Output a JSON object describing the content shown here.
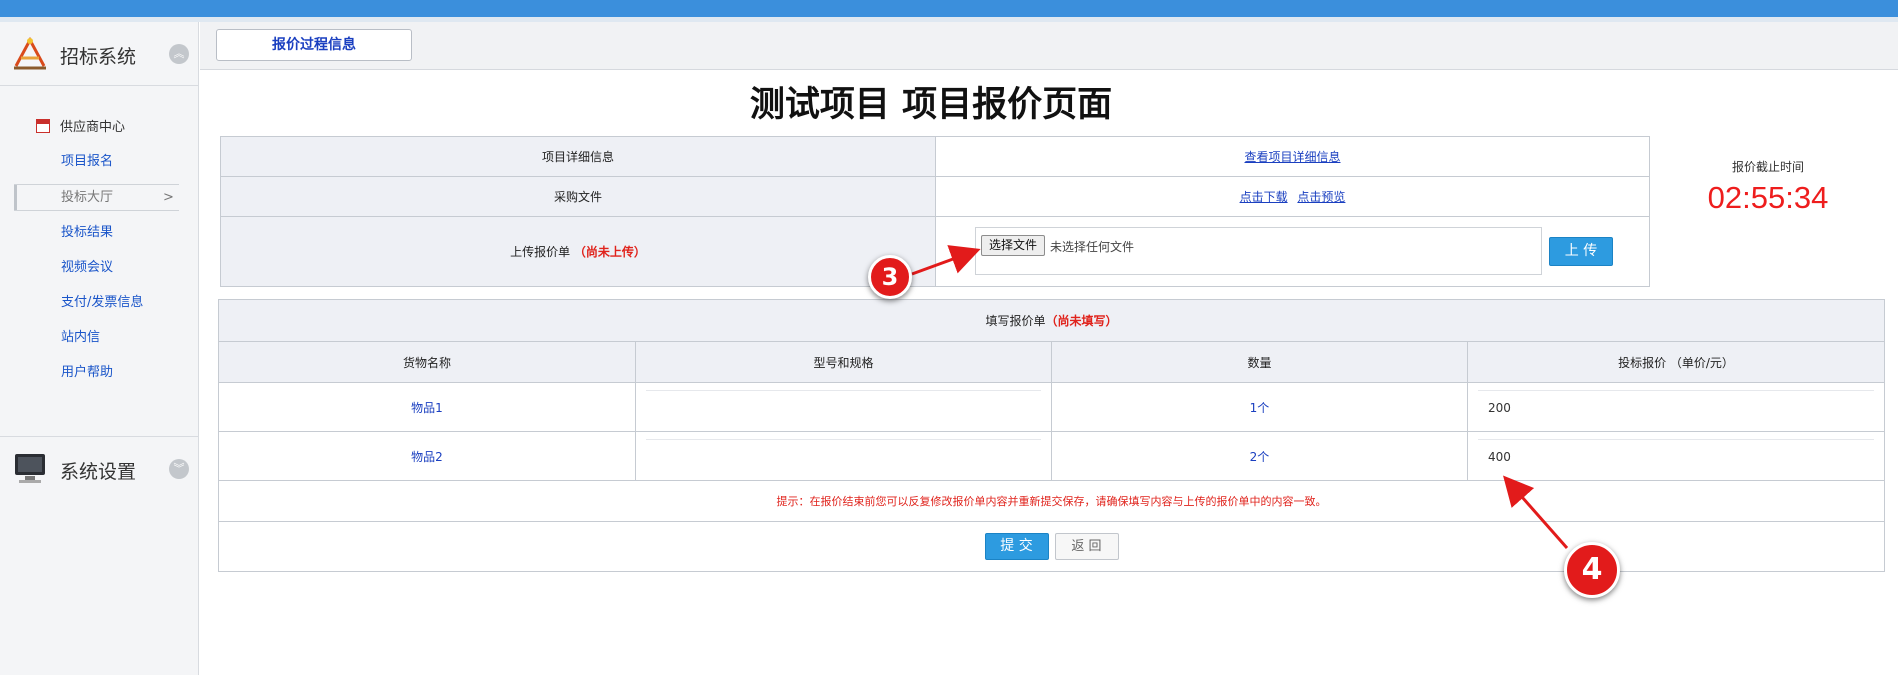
{
  "sidebar": {
    "section1_title": "招标系统",
    "section2_title": "系统设置",
    "parent_label": "供应商中心",
    "items": [
      {
        "label": "项目报名"
      },
      {
        "label": "投标大厅"
      },
      {
        "label": "投标结果"
      },
      {
        "label": "视频会议"
      },
      {
        "label": "支付/发票信息"
      },
      {
        "label": "站内信"
      },
      {
        "label": "用户帮助"
      }
    ]
  },
  "tab": {
    "label": "报价过程信息"
  },
  "page": {
    "title": "测试项目 项目报价页面"
  },
  "info": {
    "row1_label": "项目详细信息",
    "row1_link": "查看项目详细信息",
    "row2_label": "采购文件",
    "download_link": "点击下载",
    "preview_link": "点击预览",
    "row3_label": "上传报价单",
    "row3_status": "（尚未上传）",
    "file_button": "选择文件",
    "file_status": "未选择任何文件",
    "upload_button": "上 传"
  },
  "deadline": {
    "label": "报价截止时间",
    "value": "02:55:34"
  },
  "quote": {
    "title": "填写报价单",
    "status": "（尚未填写）",
    "columns": [
      "货物名称",
      "型号和规格",
      "数量",
      "投标报价 （单价/元）"
    ],
    "rows": [
      {
        "name": "物品1",
        "spec": "",
        "qty": "1个",
        "price": "200"
      },
      {
        "name": "物品2",
        "spec": "",
        "qty": "2个",
        "price": "400"
      }
    ],
    "tip": "提示：在报价结束前您可以反复修改报价单内容并重新提交保存，请确保填写内容与上传的报价单中的内容一致。",
    "submit_button": "提 交",
    "back_button": "返 回"
  },
  "annotations": {
    "marker3": "3",
    "marker4": "4"
  },
  "colors": {
    "accent": "#3b8fdc",
    "button": "#2d9be0",
    "alert": "#e0231c",
    "link": "#1a3fc0"
  }
}
